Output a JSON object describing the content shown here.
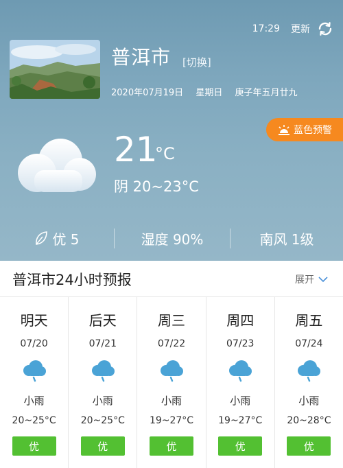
{
  "header": {
    "time": "17:29",
    "refresh_label": "更新",
    "city": "普洱市",
    "switch_label": "[切换]",
    "date": "2020年07月19日",
    "weekday": "星期日",
    "lunar_date": "庚子年五月廿九",
    "alert_label": "蓝色预警",
    "alert_color": "#f6891f"
  },
  "current": {
    "temperature": "21",
    "unit": "°C",
    "condition_line": "阴 20~23°C",
    "icon": "cloud-icon"
  },
  "stats": {
    "aqi": "优 5",
    "humidity": "湿度 90%",
    "wind": "南风 1级"
  },
  "forecast": {
    "title": "普洱市24小时预报",
    "expand_label": "展开",
    "days": [
      {
        "name": "明天",
        "date": "07/20",
        "condition": "小雨",
        "range": "20~25°C",
        "aqi": "优",
        "icon": "rain-cloud-icon"
      },
      {
        "name": "后天",
        "date": "07/21",
        "condition": "小雨",
        "range": "20~25°C",
        "aqi": "优",
        "icon": "rain-cloud-icon"
      },
      {
        "name": "周三",
        "date": "07/22",
        "condition": "小雨",
        "range": "19~27°C",
        "aqi": "优",
        "icon": "rain-cloud-icon"
      },
      {
        "name": "周四",
        "date": "07/23",
        "condition": "小雨",
        "range": "19~27°C",
        "aqi": "优",
        "icon": "rain-cloud-icon"
      },
      {
        "name": "周五",
        "date": "07/24",
        "condition": "小雨",
        "range": "20~28°C",
        "aqi": "优",
        "icon": "rain-cloud-icon"
      }
    ],
    "aqi_color": "#53c032",
    "rain_icon_color": "#4aa3d6"
  }
}
